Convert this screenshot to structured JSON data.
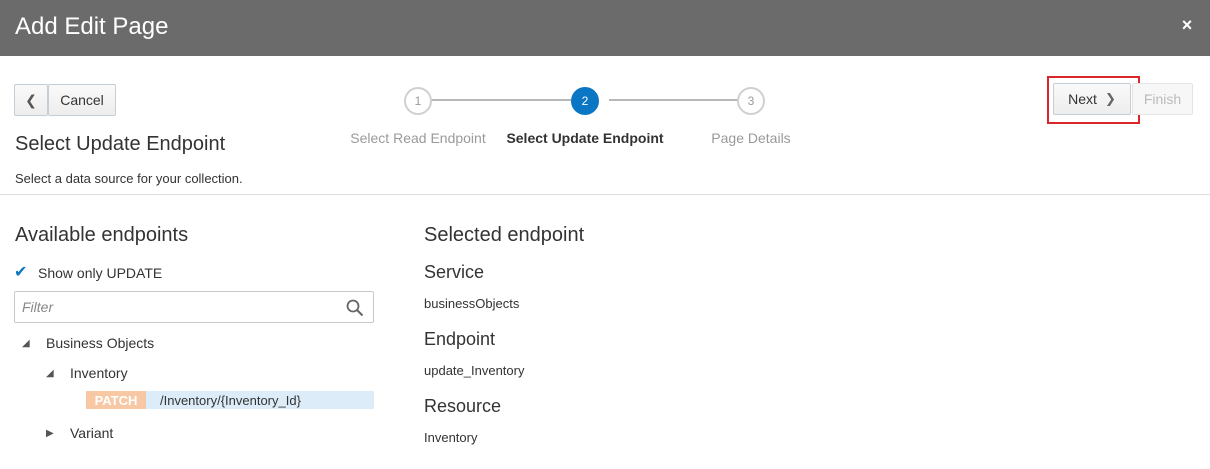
{
  "dialog": {
    "title": "Add Edit Page",
    "close_glyph": "×"
  },
  "toolbar": {
    "back_glyph": "❮",
    "cancel_label": "Cancel",
    "next_label": "Next",
    "next_glyph": "❯",
    "finish_label": "Finish"
  },
  "train": {
    "current_step": 2,
    "steps": [
      {
        "number": "1",
        "label": "Select Read Endpoint"
      },
      {
        "number": "2",
        "label": "Select Update Endpoint"
      },
      {
        "number": "3",
        "label": "Page Details"
      }
    ]
  },
  "page": {
    "heading": "Select Update Endpoint",
    "description": "Select a data source for your collection."
  },
  "available": {
    "heading": "Available endpoints",
    "checkbox_label": "Show only UPDATE",
    "checkbox_checked": true,
    "filter_placeholder": "Filter",
    "tree": {
      "root": "Business Objects",
      "child1": "Inventory",
      "method": "PATCH",
      "path": "/Inventory/{Inventory_Id}",
      "child2": "Variant"
    }
  },
  "selected": {
    "heading": "Selected endpoint",
    "service_label": "Service",
    "service_value": "businessObjects",
    "endpoint_label": "Endpoint",
    "endpoint_value": "update_Inventory",
    "resource_label": "Resource",
    "resource_value": "Inventory"
  },
  "colors": {
    "titlebar": "#6b6b6b",
    "accent": "#0a76c4",
    "patch_badge": "#f8c8a5",
    "selected_row": "#dcecf9",
    "highlight": "#d9262a"
  }
}
